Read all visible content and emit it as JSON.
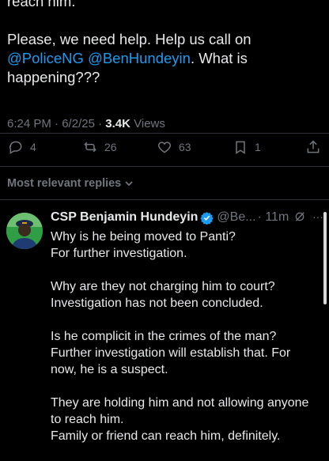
{
  "post": {
    "line1": "reach him.",
    "line2_prefix": "Please, we need help. Help us call on",
    "mention1": "@PoliceNG",
    "mention2": "@BenHundeyin",
    "line2_suffix": ". What is happening???",
    "time": "6:24 PM",
    "date": "6/2/25",
    "views_count": "3.4K",
    "views_label": "Views"
  },
  "actions": {
    "replies": "4",
    "reposts": "26",
    "likes": "63",
    "bookmarks": "1"
  },
  "replies_sort": {
    "label": "Most relevant replies"
  },
  "reply": {
    "name": "CSP Benjamin Hundeyin",
    "handle": "@Be...",
    "time": "· 11m",
    "more": "···",
    "paragraphs": [
      {
        "q": "Why is he being moved to Panti?",
        "a": "For further investigation."
      },
      {
        "q": "Why are they not charging him to court?",
        "a": "Investigation has not been concluded."
      },
      {
        "q": "Is he complicit in the crimes of the man?",
        "a": "Further investigation will establish that. For now, he is a suspect."
      },
      {
        "q": "They are holding him and not allowing anyone to reach him.",
        "a": "Family or friend can reach him, definitely."
      }
    ]
  },
  "colors": {
    "background": "#000000",
    "text": "#e7e9ea",
    "muted": "#71767b",
    "link": "#1d9bf0",
    "verified": "#1d9bf0"
  }
}
